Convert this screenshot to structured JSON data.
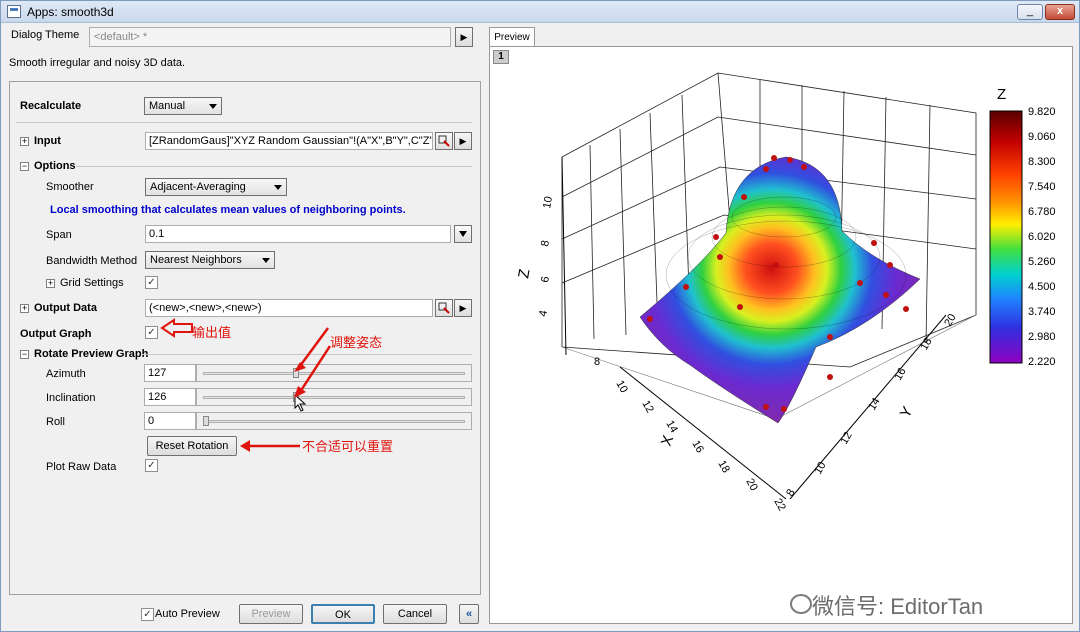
{
  "window": {
    "title": "Apps: smooth3d",
    "minimize": "_",
    "close": "x"
  },
  "dialog": {
    "theme_label": "Dialog Theme",
    "theme_value": "<default> *",
    "theme_btn": "▶",
    "description": "Smooth irregular and noisy 3D data.",
    "recalculate": {
      "label": "Recalculate",
      "value": "Manual"
    },
    "input": {
      "label": "Input",
      "value": "[ZRandomGaus]\"XYZ Random Gaussian\"!(A\"X\",B\"Y\",C\"Z\")",
      "toggle": "+"
    },
    "options": {
      "label": "Options",
      "toggle": "−"
    },
    "smoother": {
      "label": "Smoother",
      "value": "Adjacent-Averaging"
    },
    "smoother_hint": "Local smoothing that calculates mean values of neighboring points.",
    "span": {
      "label": "Span",
      "value": "0.1"
    },
    "bandwidth": {
      "label": "Bandwidth Method",
      "value": "Nearest Neighbors"
    },
    "grid_settings": {
      "label": "Grid Settings",
      "toggle": "+",
      "checked": "✓"
    },
    "output_data": {
      "label": "Output Data",
      "value": "(<new>,<new>,<new>)",
      "toggle": "+"
    },
    "output_graph": {
      "label": "Output Graph",
      "checked": "✓"
    },
    "rotate": {
      "label": "Rotate Preview Graph",
      "toggle": "−"
    },
    "azimuth": {
      "label": "Azimuth",
      "value": "127",
      "level": 0.35
    },
    "inclination": {
      "label": "Inclination",
      "value": "126",
      "level": 0.35
    },
    "roll": {
      "label": "Roll",
      "value": "0",
      "level": 0.0
    },
    "reset_btn": "Reset Rotation",
    "plot_raw": {
      "label": "Plot Raw Data",
      "checked": "✓"
    },
    "auto_preview": {
      "label": "Auto Preview",
      "checked": "✓"
    },
    "preview_btn": "Preview",
    "ok_btn": "OK",
    "cancel_btn": "Cancel",
    "collapse_btn": "«"
  },
  "annotations": {
    "output_value": "输出值",
    "adjust_pose": "调整姿态",
    "reset_hint": "不合适可以重置"
  },
  "preview": {
    "tab": "Preview",
    "layer": "1",
    "watermark": "微信号: EditorTan",
    "colorbar": {
      "title": "Z",
      "ticks": [
        "9.820",
        "9.060",
        "8.300",
        "7.540",
        "6.780",
        "6.020",
        "5.260",
        "4.500",
        "3.740",
        "2.980",
        "2.220"
      ]
    },
    "axes": {
      "x_label": "X",
      "y_label": "Y",
      "z_label": "Z",
      "x_ticks": [
        "8",
        "10",
        "12",
        "14",
        "16",
        "18",
        "20",
        "22"
      ],
      "y_ticks": [
        "8",
        "10",
        "12",
        "14",
        "16",
        "18",
        "20"
      ],
      "z_ticks": [
        "4",
        "6",
        "8",
        "10"
      ]
    }
  },
  "colors": {
    "accent": "#e0140e",
    "hint_text": "#0000cc"
  }
}
